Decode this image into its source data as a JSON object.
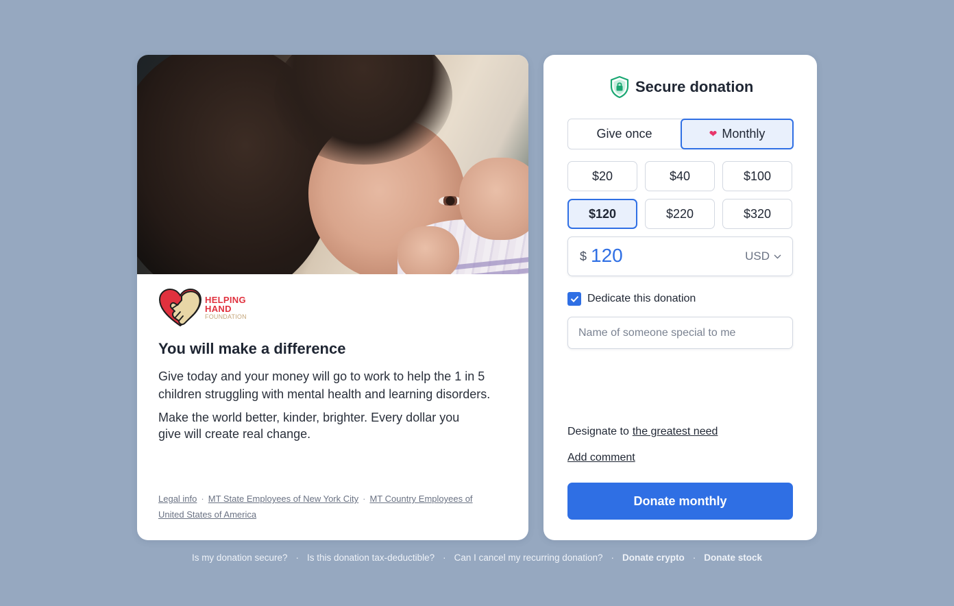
{
  "brand": {
    "line1": "HELPING",
    "line2": "HAND",
    "line3": "FOUNDATION",
    "colors": {
      "red": "#e0313e",
      "tan": "#c4a57a"
    }
  },
  "story": {
    "headline": "You will make a difference",
    "paragraph1": "Give today and your money will go to work to help the 1 in 5 children struggling with mental health and learning disorders.",
    "paragraph2": "Make the world better, kinder, brighter. Every dollar you give will create real change."
  },
  "legal_links": [
    "Legal info",
    "MT State Employees of New York City",
    "MT Country Employees of United States of America"
  ],
  "donation": {
    "title": "Secure donation",
    "frequency": {
      "once": "Give once",
      "monthly": "Monthly",
      "selected": "monthly"
    },
    "amounts": [
      "$20",
      "$40",
      "$100",
      "$120",
      "$220",
      "$320"
    ],
    "selected_amount": "$120",
    "currency_symbol": "$",
    "amount_value": "120",
    "currency": "USD",
    "dedicate_label": "Dedicate this donation",
    "dedicate_checked": true,
    "dedicate_placeholder": "Name of someone special to me",
    "designate_prefix": "Designate to",
    "designate_link": "the greatest need",
    "add_comment": "Add comment",
    "submit_label": "Donate monthly",
    "accent": "#2f6fe4",
    "shield_color": "#1aa772"
  },
  "footer": {
    "links": [
      "Is my donation secure?",
      "Is this donation tax-deductible?",
      "Can I cancel my recurring donation?",
      "Donate crypto",
      "Donate stock"
    ],
    "separator": "·"
  }
}
